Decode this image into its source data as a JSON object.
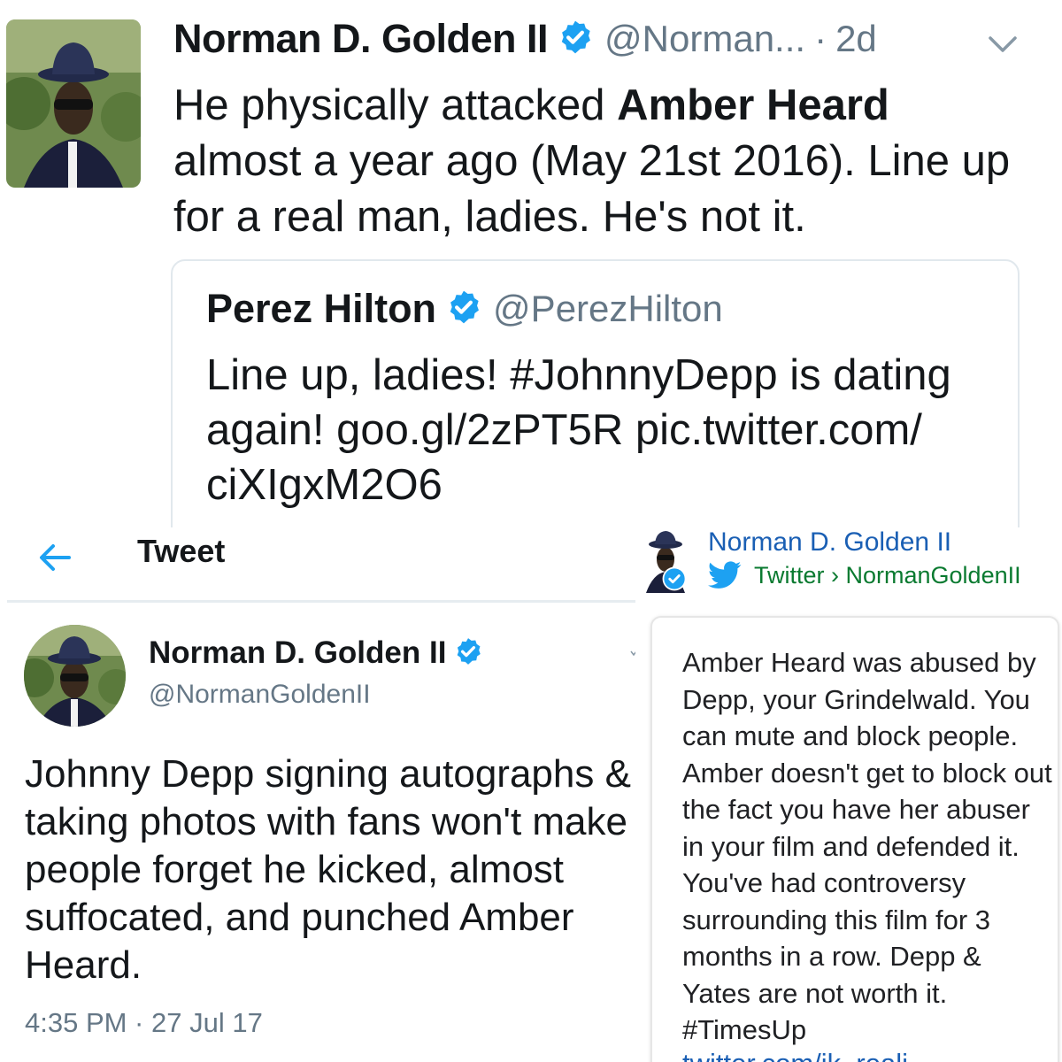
{
  "quoted_tweet": {
    "author_name": "Norman D. Golden II",
    "handle": "@Norman...",
    "separator": "·",
    "time_ago": "2d",
    "text_before_bold": "He physically attacked ",
    "bold_text": "Amber Heard",
    "text_after_bold": " almost a year ago (May 21st 2016). Line up for a real man, ladies. He's not it.",
    "quote": {
      "author_name": "Perez Hilton",
      "handle": "@PerezHilton",
      "text": "Line up, ladies! #JohnnyDepp is dating again! goo.gl/2zPT5R pic.twitter.com/ ciXIgxM2O6"
    }
  },
  "tweet_detail": {
    "header_title": "Tweet",
    "author_name": "Norman D. Golden II",
    "handle": "@NormanGoldenII",
    "text": "Johnny Depp signing autographs & taking photos with fans won't make people forget he kicked, almost suffocated, and punched Amber Heard.",
    "timestamp": "4:35 PM · 27 Jul 17"
  },
  "search_result": {
    "title": "Norman D. Golden II",
    "source": "Twitter › NormanGoldenII",
    "text": "Amber Heard was abused by Depp, your Grindelwald. You can mute and block people. Amber doesn't get to block out the fact you have her abuser in your film and defended it. You've had controversy surrounding this film for 3 months in a row. Depp & Yates are not worth it. #TimesUp",
    "cut_off_link": "twitter.com/ik_reali..."
  },
  "icons": {
    "verified": "verified-badge-icon",
    "caret": "chevron-down-icon",
    "back": "back-arrow-icon",
    "bird": "twitter-bird-icon"
  },
  "colors": {
    "twitter_blue": "#1da1f2",
    "link_blue": "#1a5fb4",
    "source_green": "#0a7a30",
    "muted_gray": "#657786"
  }
}
